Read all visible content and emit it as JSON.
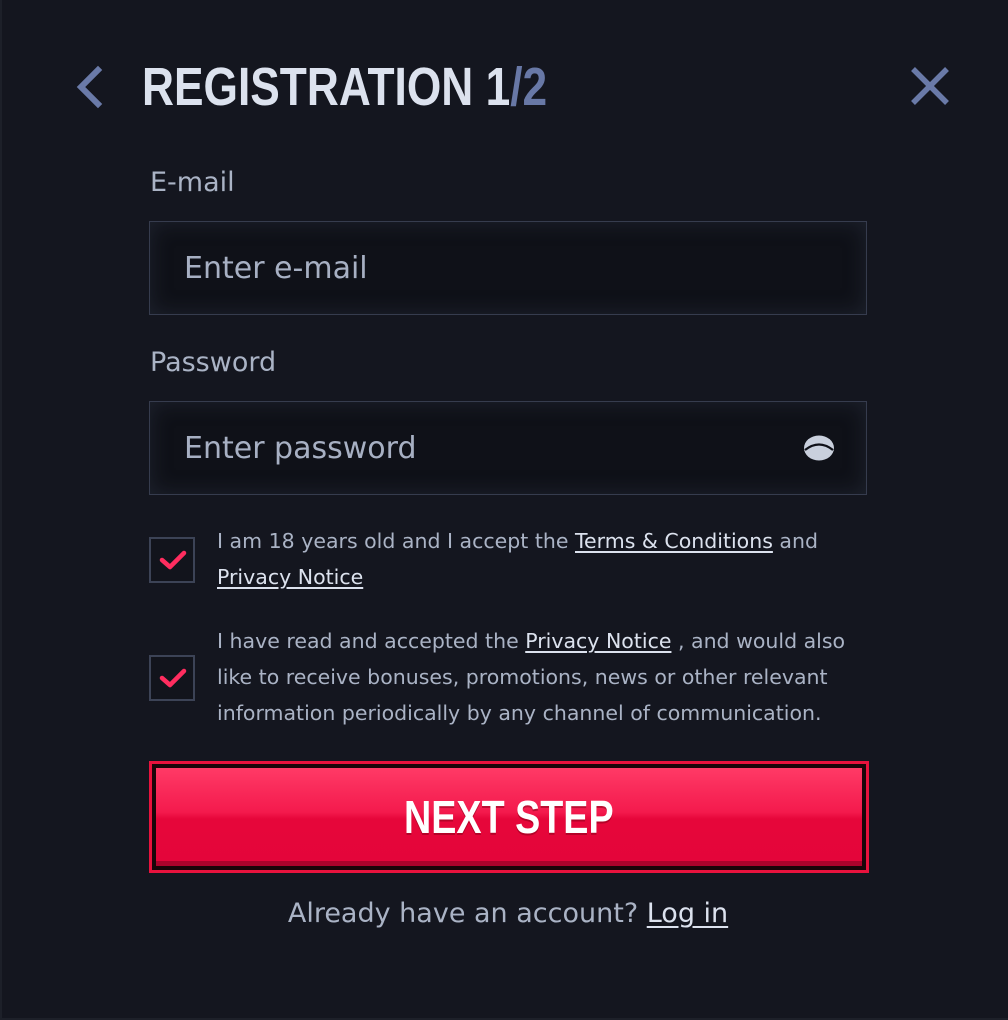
{
  "header": {
    "title": "REGISTRATION",
    "step_current": "1",
    "step_separator": "/",
    "step_total": "2",
    "back_icon": "chevron-left-icon",
    "close_icon": "close-icon"
  },
  "form": {
    "email": {
      "label": "E-mail",
      "placeholder": "Enter e-mail",
      "value": ""
    },
    "password": {
      "label": "Password",
      "placeholder": "Enter password",
      "value": "",
      "toggle_icon": "eye-icon"
    },
    "consents": [
      {
        "checked": true,
        "text_before": "I am 18 years old and I accept the ",
        "link1": "Terms & Conditions",
        "text_middle": " and ",
        "link2": "Privacy Notice",
        "text_after": ""
      },
      {
        "checked": true,
        "text_before": "I have read and accepted the ",
        "link1": "Privacy Notice",
        "text_after": " , and would also like to receive bonuses, promotions, news or other relevant information periodically by any channel of communication."
      }
    ],
    "submit_label": "NEXT STEP"
  },
  "footer": {
    "prompt": "Already have an account? ",
    "login_link": "Log in"
  },
  "colors": {
    "background": "#14161f",
    "accent": "#e8123d",
    "check": "#ff2d5f",
    "text_primary": "#dce2ee",
    "text_secondary": "#aab3c5",
    "step_muted": "#6878a6"
  }
}
